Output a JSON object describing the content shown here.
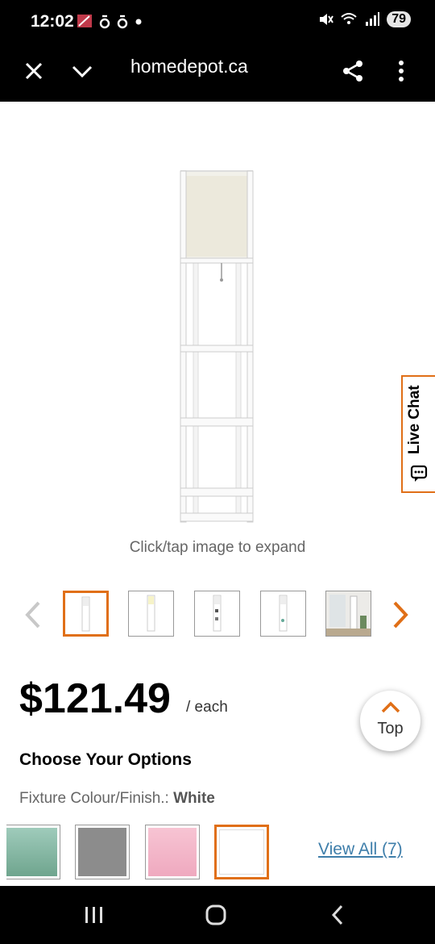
{
  "status": {
    "time": "12:02",
    "battery": "79",
    "icons": [
      "nfc-bars-icon",
      "notification-icon",
      "notification-icon",
      "dot-icon",
      "mute-icon",
      "wifi-icon",
      "signal-icon"
    ]
  },
  "browser": {
    "url": "homedepot.ca",
    "close_icon": "close-icon",
    "tabs_icon": "chevron-down-icon",
    "share_icon": "share-icon",
    "menu_icon": "more-vertical-icon"
  },
  "product": {
    "expand_hint": "Click/tap image to expand",
    "price": "$121.49",
    "price_unit": "/ each",
    "options_title": "Choose Your Options",
    "finish_label": "Fixture Colour/Finish.:",
    "finish_value": "White",
    "view_all": "View All (7)",
    "swatch_colors": [
      "#7fb7a3",
      "#8c8c8c",
      "#f4b6c9",
      "#ffffff"
    ],
    "accent": "#e06f17",
    "link_color": "#3e7eaa"
  },
  "top_button": {
    "label": "Top"
  },
  "live_chat": {
    "label": "Live Chat"
  },
  "nav": {
    "icons": [
      "recent-apps-icon",
      "home-icon",
      "back-icon"
    ]
  }
}
